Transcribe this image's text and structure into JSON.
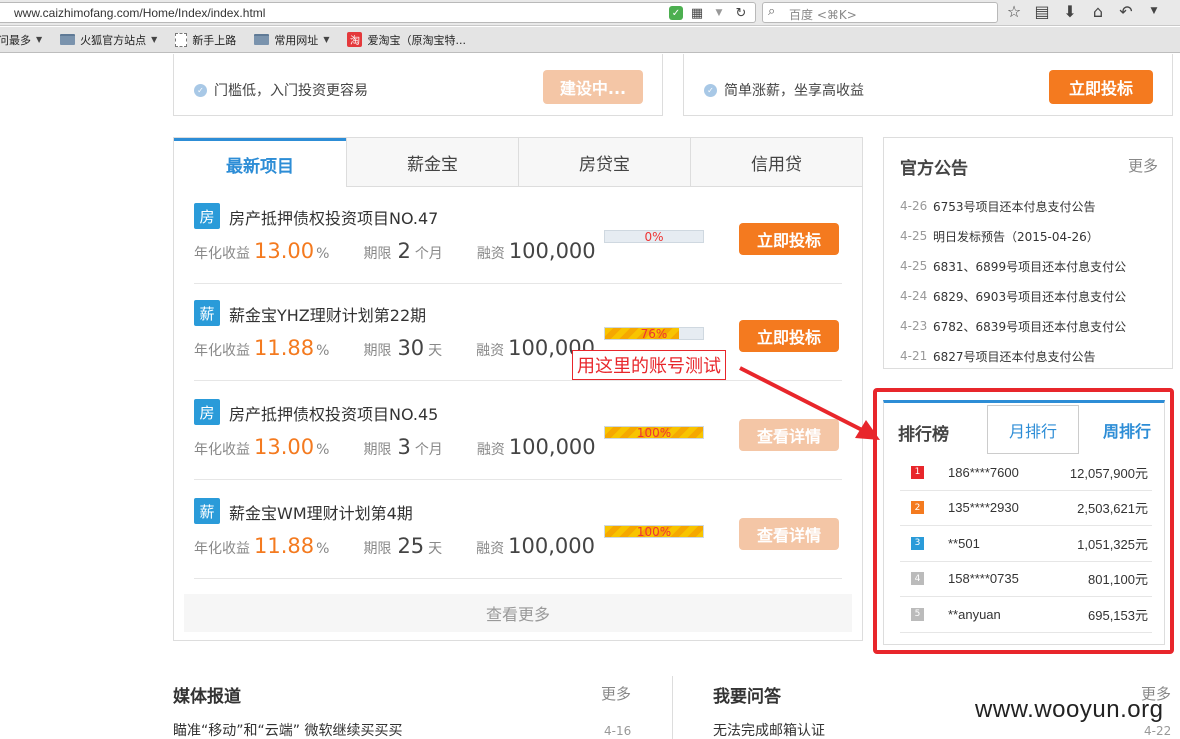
{
  "browser": {
    "url": "www.caizhimofang.com/Home/Index/index.html",
    "search_placeholder": "百度 <⌘K>",
    "icons": [
      "shield-icon",
      "qr-icon",
      "dropdown-icon",
      "reload-icon",
      "search-icon",
      "star-icon",
      "reader-icon",
      "download-icon",
      "home-icon",
      "back-icon",
      "menu-icon"
    ]
  },
  "bookmarks": [
    {
      "label": "问最多",
      "icon": "none",
      "caret": true
    },
    {
      "label": "火狐官方站点",
      "icon": "folder",
      "caret": true
    },
    {
      "label": "新手上路",
      "icon": "page",
      "caret": false
    },
    {
      "label": "常用网址",
      "icon": "folder",
      "caret": true
    },
    {
      "label": "爱淘宝（原淘宝特...",
      "icon": "taobao",
      "caret": false
    }
  ],
  "top_cards": [
    {
      "feature": "门槛低，入门投资更容易",
      "button": "建设中..."
    },
    {
      "feature": "简单涨薪，坐享高收益",
      "button": "立即投标"
    }
  ],
  "tabs": [
    "最新项目",
    "薪金宝",
    "房贷宝",
    "信用贷"
  ],
  "projects": {
    "labels": {
      "rate": "年化收益",
      "term": "期限",
      "amount": "融资",
      "percent": "%"
    },
    "items": [
      {
        "badge": "房",
        "title": "房产抵押债权投资项目NO.47",
        "rate": "13.00",
        "term": "2",
        "term_unit": "个月",
        "amount": "100,000",
        "progress": 0,
        "progress_label": "0%",
        "button": "立即投标",
        "button_state": "active"
      },
      {
        "badge": "薪",
        "title": "薪金宝YHZ理财计划第22期",
        "rate": "11.88",
        "term": "30",
        "term_unit": "天",
        "amount": "100,000",
        "progress": 76,
        "progress_label": "76%",
        "button": "立即投标",
        "button_state": "active"
      },
      {
        "badge": "房",
        "title": "房产抵押债权投资项目NO.45",
        "rate": "13.00",
        "term": "3",
        "term_unit": "个月",
        "amount": "100,000",
        "progress": 100,
        "progress_label": "100%",
        "button": "查看详情",
        "button_state": "disabled"
      },
      {
        "badge": "薪",
        "title": "薪金宝WM理财计划第4期",
        "rate": "11.88",
        "term": "25",
        "term_unit": "天",
        "amount": "100,000",
        "progress": 100,
        "progress_label": "100%",
        "button": "查看详情",
        "button_state": "disabled"
      }
    ],
    "see_more": "查看更多"
  },
  "notice": {
    "title": "官方公告",
    "more": "更多",
    "items": [
      {
        "date": "4-26",
        "text": "6753号项目还本付息支付公告"
      },
      {
        "date": "4-25",
        "text": "明日发标预告（2015-04-26）"
      },
      {
        "date": "4-25",
        "text": "6831、6899号项目还本付息支付公"
      },
      {
        "date": "4-24",
        "text": "6829、6903号项目还本付息支付公"
      },
      {
        "date": "4-23",
        "text": "6782、6839号项目还本付息支付公"
      },
      {
        "date": "4-21",
        "text": "6827号项目还本付息支付公告"
      }
    ]
  },
  "ranking": {
    "title": "排行榜",
    "tab_month": "月排行",
    "tab_week": "周排行",
    "rows": [
      {
        "rank": "1",
        "user": "186****7600",
        "amount": "12,057,900元",
        "color": "#e8262b"
      },
      {
        "rank": "2",
        "user": "135****2930",
        "amount": "2,503,621元",
        "color": "#f47a1f"
      },
      {
        "rank": "3",
        "user": "**501",
        "amount": "1,051,325元",
        "color": "#2a9bd9"
      },
      {
        "rank": "4",
        "user": "158****0735",
        "amount": "801,100元",
        "color": "#bbbbbb"
      },
      {
        "rank": "5",
        "user": "**anyuan",
        "amount": "695,153元",
        "color": "#bbbbbb"
      }
    ]
  },
  "annotation": {
    "text": "用这里的账号测试"
  },
  "media": {
    "title": "媒体报道",
    "more": "更多",
    "item": "瞄准“移动”和“云端” 微软继续买买买",
    "date": "4-16"
  },
  "qa": {
    "title": "我要问答",
    "more": "更多",
    "item": "无法完成邮箱认证",
    "date": "4-22"
  },
  "watermark": "www.wooyun.org"
}
